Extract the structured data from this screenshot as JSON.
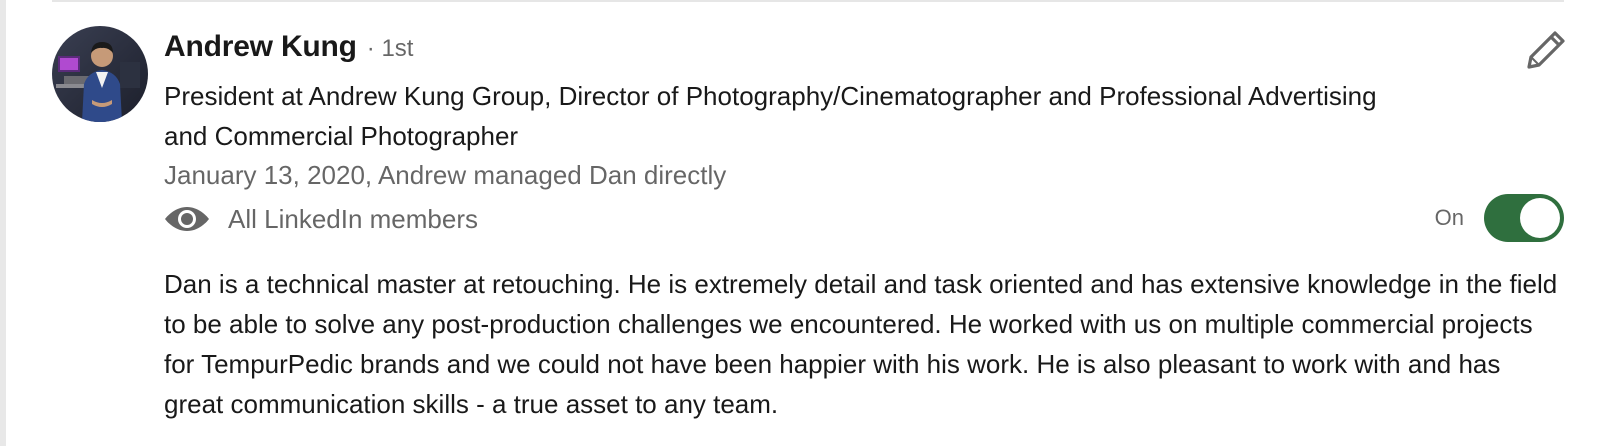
{
  "recommendation": {
    "recommender": {
      "name": "Andrew Kung",
      "degree": "· 1st",
      "headline": "President at Andrew Kung Group, Director of Photography/Cinematographer and Professional Advertising and Commercial Photographer",
      "avatar_icon": "profile-photo"
    },
    "meta": "January 13, 2020, Andrew managed Dan directly",
    "visibility": {
      "icon": "eye-icon",
      "label": "All LinkedIn members"
    },
    "toggle": {
      "state_label": "On",
      "is_on": true,
      "color": "#2f6f3e"
    },
    "edit_icon": "pencil-icon",
    "text": "Dan is a technical master at retouching. He is extremely detail and task oriented and has extensive knowledge in the field to be able to solve any post-production challenges we encountered. He worked with us on multiple commercial projects for TempurPedic brands and we could not have been happier with his work. He is also pleasant to work with and has great communication skills - a true asset to any team."
  }
}
